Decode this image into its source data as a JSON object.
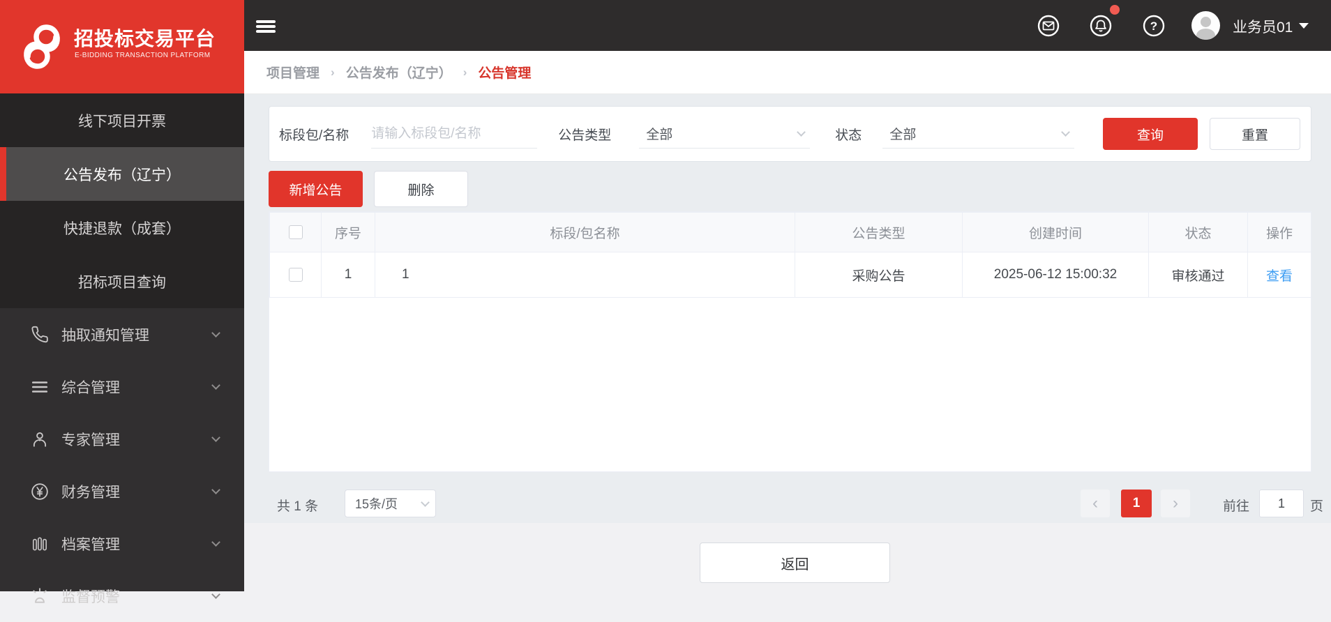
{
  "logo": {
    "title": "招投标交易平台",
    "subtitle": "E-BIDDING TRANSACTION PLATFORM"
  },
  "topbar": {
    "username": "业务员01"
  },
  "breadcrumb": {
    "items": [
      {
        "label": "项目管理"
      },
      {
        "label": "公告发布（辽宁）"
      },
      {
        "label": "公告管理"
      }
    ],
    "separator": "›"
  },
  "sidebar": {
    "submenu": [
      {
        "label": "线下项目开票"
      },
      {
        "label": "公告发布（辽宁）",
        "active": true
      },
      {
        "label": "快捷退款（成套）"
      },
      {
        "label": "招标项目查询"
      }
    ],
    "menu": [
      {
        "label": "抽取通知管理",
        "icon": "phone"
      },
      {
        "label": "综合管理",
        "icon": "list"
      },
      {
        "label": "专家管理",
        "icon": "user"
      },
      {
        "label": "财务管理",
        "icon": "yuan-circle"
      },
      {
        "label": "档案管理",
        "icon": "archive"
      },
      {
        "label": "监督预警",
        "icon": "alarm"
      }
    ]
  },
  "filters": {
    "name_label": "标段包/名称",
    "name_placeholder": "请输入标段包/名称",
    "name_value": "",
    "type_label": "公告类型",
    "type_value": "全部",
    "status_label": "状态",
    "status_value": "全部",
    "search_label": "查询",
    "reset_label": "重置"
  },
  "toolbar": {
    "add_label": "新增公告",
    "delete_label": "删除"
  },
  "table": {
    "headers": {
      "seq": "序号",
      "name": "标段/包名称",
      "type": "公告类型",
      "created": "创建时间",
      "status": "状态",
      "action": "操作"
    },
    "rows": [
      {
        "seq": "1",
        "name": "1",
        "type": "采购公告",
        "created": "2025-06-12 15:00:32",
        "status": "审核通过",
        "action": "查看"
      }
    ]
  },
  "pagination": {
    "total": "共 1 条",
    "page_size": "15条/页",
    "prev": "‹",
    "current": "1",
    "next": "›",
    "goto_label": "前往",
    "page_value": "1",
    "unit": "页"
  },
  "footer": {
    "back_label": "返回"
  },
  "colors": {
    "primary": "#e1352b",
    "link": "#3d9df3",
    "topbar_bg": "#2e2c2c",
    "content_bg": "#eaedf0"
  }
}
